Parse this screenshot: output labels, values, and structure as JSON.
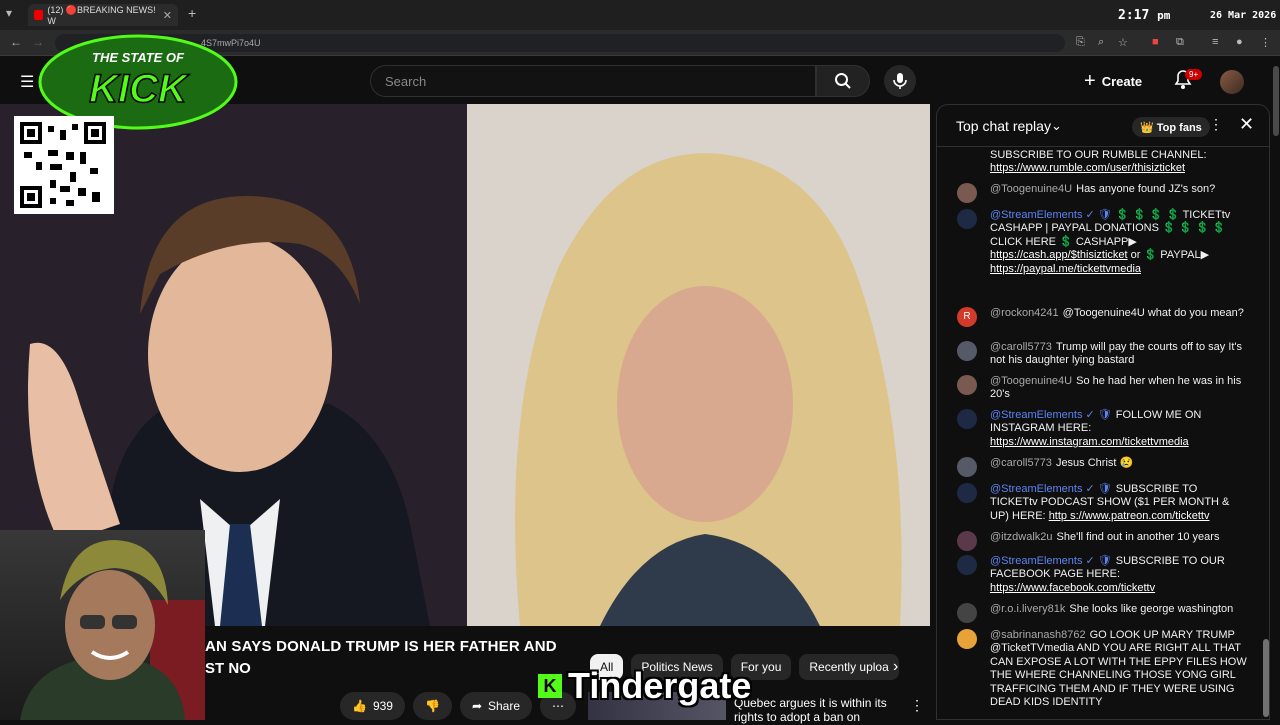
{
  "browser": {
    "tab_title": "(12) 🔴BREAKING NEWS! W",
    "url": "4S7mwPi7o4U"
  },
  "clock": {
    "time": "2:17",
    "meridiem": "pm",
    "date": "26 Mar 2026"
  },
  "youtube": {
    "search_placeholder": "Search",
    "create_label": "Create",
    "notification_count": "9+"
  },
  "overlay": {
    "logo_top": "THE STATE OF",
    "logo_main": "KICK",
    "caption": "Tindergate"
  },
  "video": {
    "title_line1": "AN SAYS DONALD TRUMP IS HER FATHER AND",
    "title_line2": "ST NO",
    "like_count": "939",
    "share_label": "Share"
  },
  "chips": [
    "All",
    "Politics News",
    "For you",
    "Recently uploa"
  ],
  "recommended": {
    "title": "Quebec argues it is within its rights to adopt a ban on"
  },
  "chat": {
    "title": "Top chat replay",
    "top_fans_label": "Top fans",
    "messages": [
      {
        "author": "",
        "text": "SUBSCRIBE TO OUR RUMBLE CHANNEL: ",
        "link": "https://www.rumble.com/user/thisizticket",
        "avatar": "#6a4a3a"
      },
      {
        "author": "@Toogenuine4U",
        "text": "Has anyone found JZ's son?",
        "link": "",
        "avatar": "#7a5a50"
      },
      {
        "author": "@StreamElements",
        "text": "💲 💲 💲 💲 TICKETtv CASHAPP | PAYPAL DONATIONS 💲 💲 💲 💲 CLICK HERE 💲 CASHAPP▶ ",
        "link": "https://cash.app/$thisizticket",
        "text2": " or 💲 PAYPAL▶ ",
        "link2": "https://paypal.me/tickettvmedia",
        "avatar": "#1e2a44",
        "mod": true
      },
      {
        "author": "@rockon4241",
        "text": "@Toogenuine4U what do you mean?",
        "link": "",
        "avatar": "#d23a2a",
        "initial": "R"
      },
      {
        "author": "@caroll5773",
        "text": "Trump will pay the courts off to say It's not his daughter lying bastard",
        "link": "",
        "avatar": "#555a66"
      },
      {
        "author": "@Toogenuine4U",
        "text": "So he had her when he was in his 20's",
        "link": "",
        "avatar": "#7a5a50"
      },
      {
        "author": "@StreamElements",
        "text": "FOLLOW ME ON INSTAGRAM HERE: ",
        "link": "https://www.instagram.com/tickettvmedia",
        "avatar": "#1e2a44",
        "mod": true
      },
      {
        "author": "@caroll5773",
        "text": "Jesus Christ 😢",
        "link": "",
        "avatar": "#555a66"
      },
      {
        "author": "@StreamElements",
        "text": "SUBSCRIBE TO TICKETtv PODCAST SHOW ($1 PER MONTH & UP) HERE: ",
        "link": "http s://www.patreon.com/tickettv",
        "avatar": "#1e2a44",
        "mod": true
      },
      {
        "author": "@itzdwalk2u",
        "text": "She'll find out in another 10 years",
        "link": "",
        "avatar": "#5a3a4a"
      },
      {
        "author": "@StreamElements",
        "text": "SUBSCRIBE TO OUR FACEBOOK PAGE HERE: ",
        "link": "https://www.facebook.com/tickettv",
        "avatar": "#1e2a44",
        "mod": true
      },
      {
        "author": "@r.o.i.livery81k",
        "text": "She looks like george washington",
        "link": "",
        "avatar": "#444"
      },
      {
        "author": "@sabrinanash8762",
        "text": "GO LOOK UP MARY TRUMP @TicketTVmedia AND YOU ARE RIGHT ALL THAT CAN EXPOSE A LOT WITH THE EPPY FILES HOW THE WHERE CHANNELING THOSE YONG GIRL TRAFFICING THEM AND IF THEY WERE USING DEAD KIDS IDENTITY",
        "link": "",
        "avatar": "#e8a23a"
      }
    ]
  },
  "colors": {
    "yt_red": "#cc0000",
    "kick_green": "#53fc18",
    "mod_blue": "#5e84f1"
  }
}
